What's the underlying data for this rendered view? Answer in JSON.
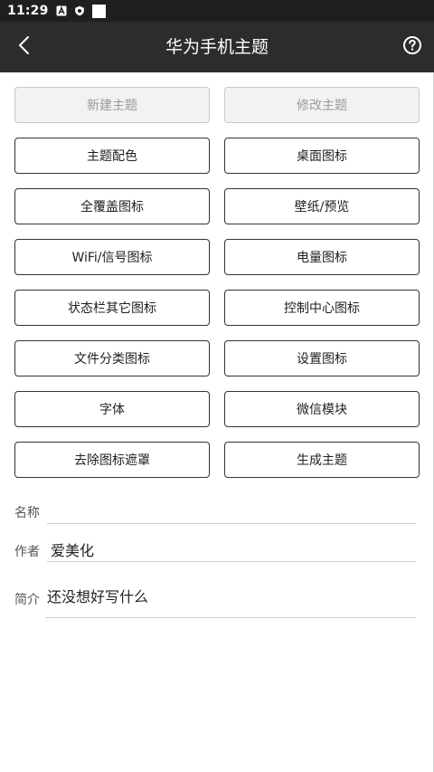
{
  "status_bar": {
    "time": "11:29",
    "icons": [
      "notification-a-icon",
      "shield-icon",
      "white-square-icon"
    ]
  },
  "toolbar": {
    "title": "华为手机主题",
    "back_icon": "chevron-left-icon",
    "help_icon": "help-circle-icon"
  },
  "buttons": [
    {
      "label": "新建主题",
      "enabled": false
    },
    {
      "label": "修改主题",
      "enabled": false
    },
    {
      "label": "主题配色",
      "enabled": true
    },
    {
      "label": "桌面图标",
      "enabled": true
    },
    {
      "label": "全覆盖图标",
      "enabled": true
    },
    {
      "label": "壁纸/预览",
      "enabled": true
    },
    {
      "label": "WiFi/信号图标",
      "enabled": true
    },
    {
      "label": "电量图标",
      "enabled": true
    },
    {
      "label": "状态栏其它图标",
      "enabled": true
    },
    {
      "label": "控制中心图标",
      "enabled": true
    },
    {
      "label": "文件分类图标",
      "enabled": true
    },
    {
      "label": "设置图标",
      "enabled": true
    },
    {
      "label": "字体",
      "enabled": true
    },
    {
      "label": "微信模块",
      "enabled": true
    },
    {
      "label": "去除图标遮罩",
      "enabled": true
    },
    {
      "label": "生成主题",
      "enabled": true
    }
  ],
  "form": {
    "name": {
      "label": "名称",
      "value": ""
    },
    "author": {
      "label": "作者",
      "value": "爱美化"
    },
    "intro": {
      "label": "简介",
      "value": "还没想好写什么"
    }
  },
  "colors": {
    "status_bar_bg": "#1f1f1f",
    "toolbar_bg": "#2c2c2c",
    "button_border": "#333333",
    "disabled_bg": "#f2f2f2",
    "disabled_text": "#9a9a9a"
  }
}
